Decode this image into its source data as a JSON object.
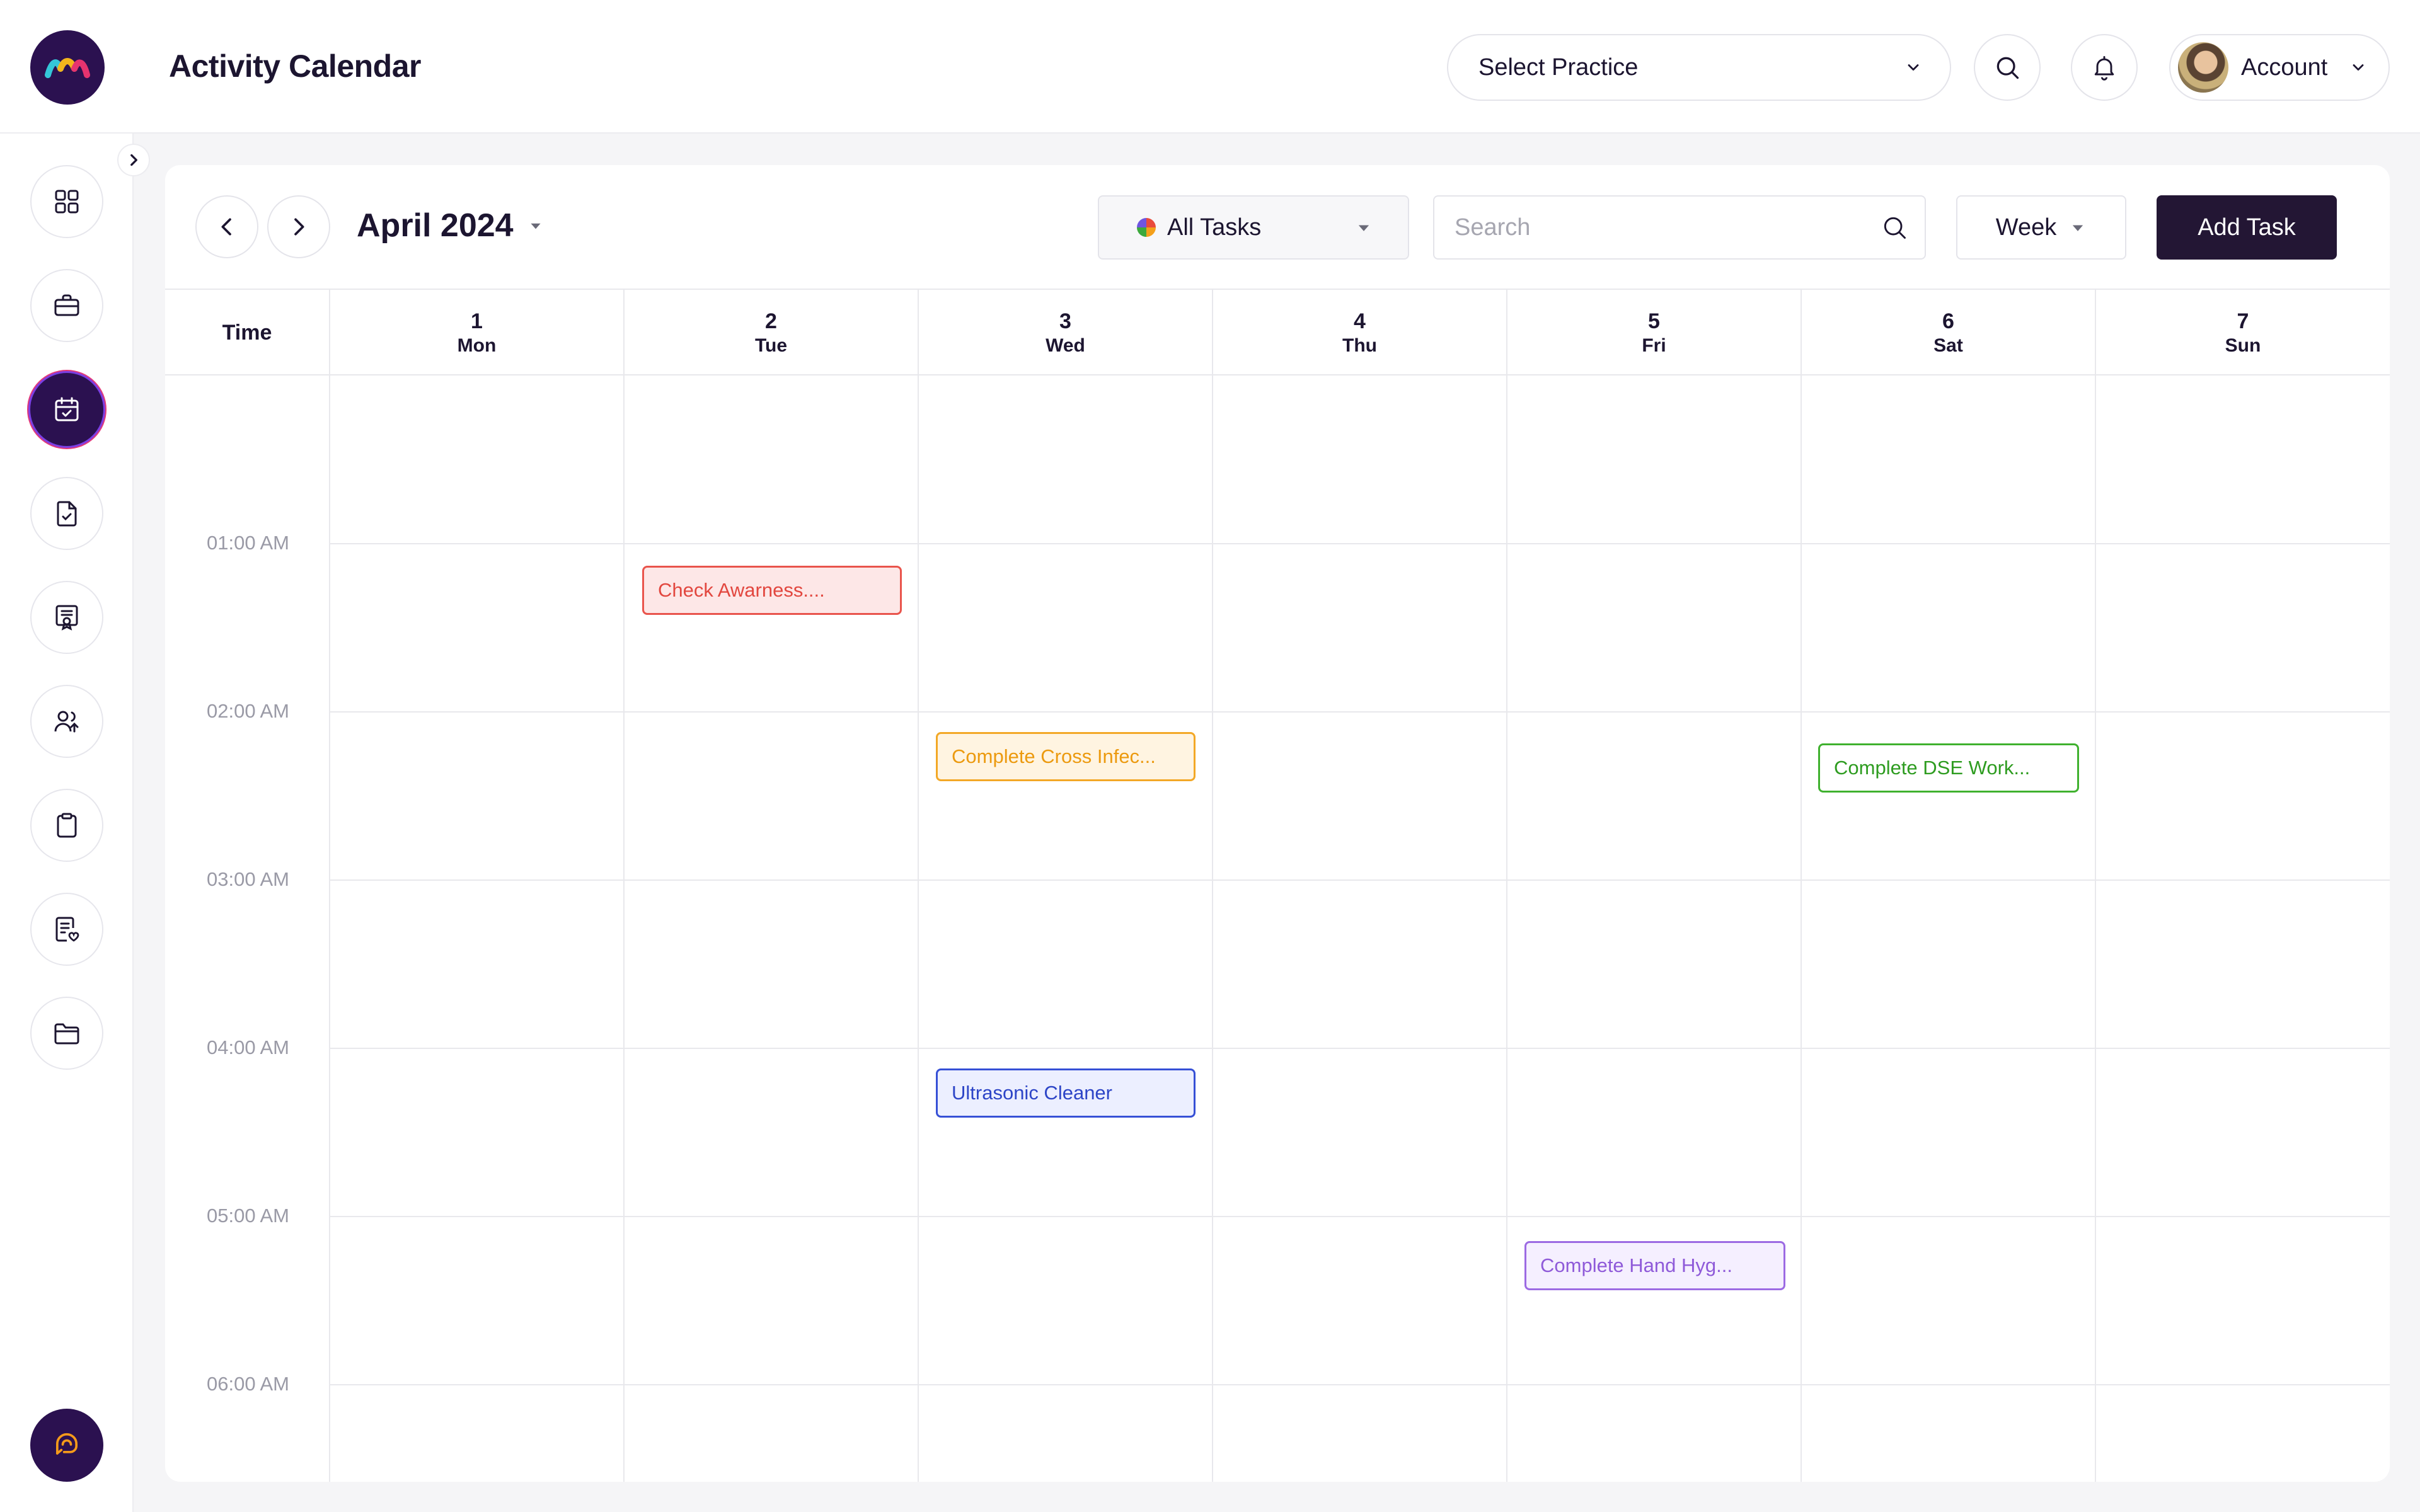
{
  "header": {
    "title": "Activity Calendar",
    "practice_select": "Select Practice",
    "account_label": "Account"
  },
  "toolbar": {
    "month_label": "April 2024",
    "filter_label": "All Tasks",
    "search_placeholder": "Search",
    "view_label": "Week",
    "add_task_label": "Add Task"
  },
  "calendar": {
    "time_header": "Time",
    "days": [
      {
        "num": "1",
        "name": "Mon"
      },
      {
        "num": "2",
        "name": "Tue"
      },
      {
        "num": "3",
        "name": "Wed"
      },
      {
        "num": "4",
        "name": "Thu"
      },
      {
        "num": "5",
        "name": "Fri"
      },
      {
        "num": "6",
        "name": "Sat"
      },
      {
        "num": "7",
        "name": "Sun"
      }
    ],
    "times": [
      "01:00 AM",
      "02:00 AM",
      "03:00 AM",
      "04:00 AM",
      "05:00 AM",
      "06:00 AM"
    ],
    "events": [
      {
        "title": "Check Awarness....",
        "day": "2",
        "color": "#e9544c"
      },
      {
        "title": "Complete Cross Infec...",
        "day": "3",
        "color": "#f3a826"
      },
      {
        "title": "Complete DSE Work...",
        "day": "6",
        "color": "#3fb12e"
      },
      {
        "title": "Ultrasonic Cleaner",
        "day": "3",
        "color": "#3650d6"
      },
      {
        "title": "Complete Hand Hyg...",
        "day": "5",
        "color": "#9c6ae3"
      }
    ]
  },
  "sidebar": {
    "items": [
      {
        "icon": "dashboard-grid-icon"
      },
      {
        "icon": "briefcase-icon"
      },
      {
        "icon": "calendar-check-icon",
        "active": true
      },
      {
        "icon": "document-check-icon"
      },
      {
        "icon": "certificate-icon"
      },
      {
        "icon": "users-icon"
      },
      {
        "icon": "clipboard-icon"
      },
      {
        "icon": "document-heart-icon"
      },
      {
        "icon": "folder-icon"
      }
    ],
    "support_icon": "chat-support-icon"
  },
  "colors": {
    "brand": "#2b1150",
    "primary_button": "#231634"
  }
}
